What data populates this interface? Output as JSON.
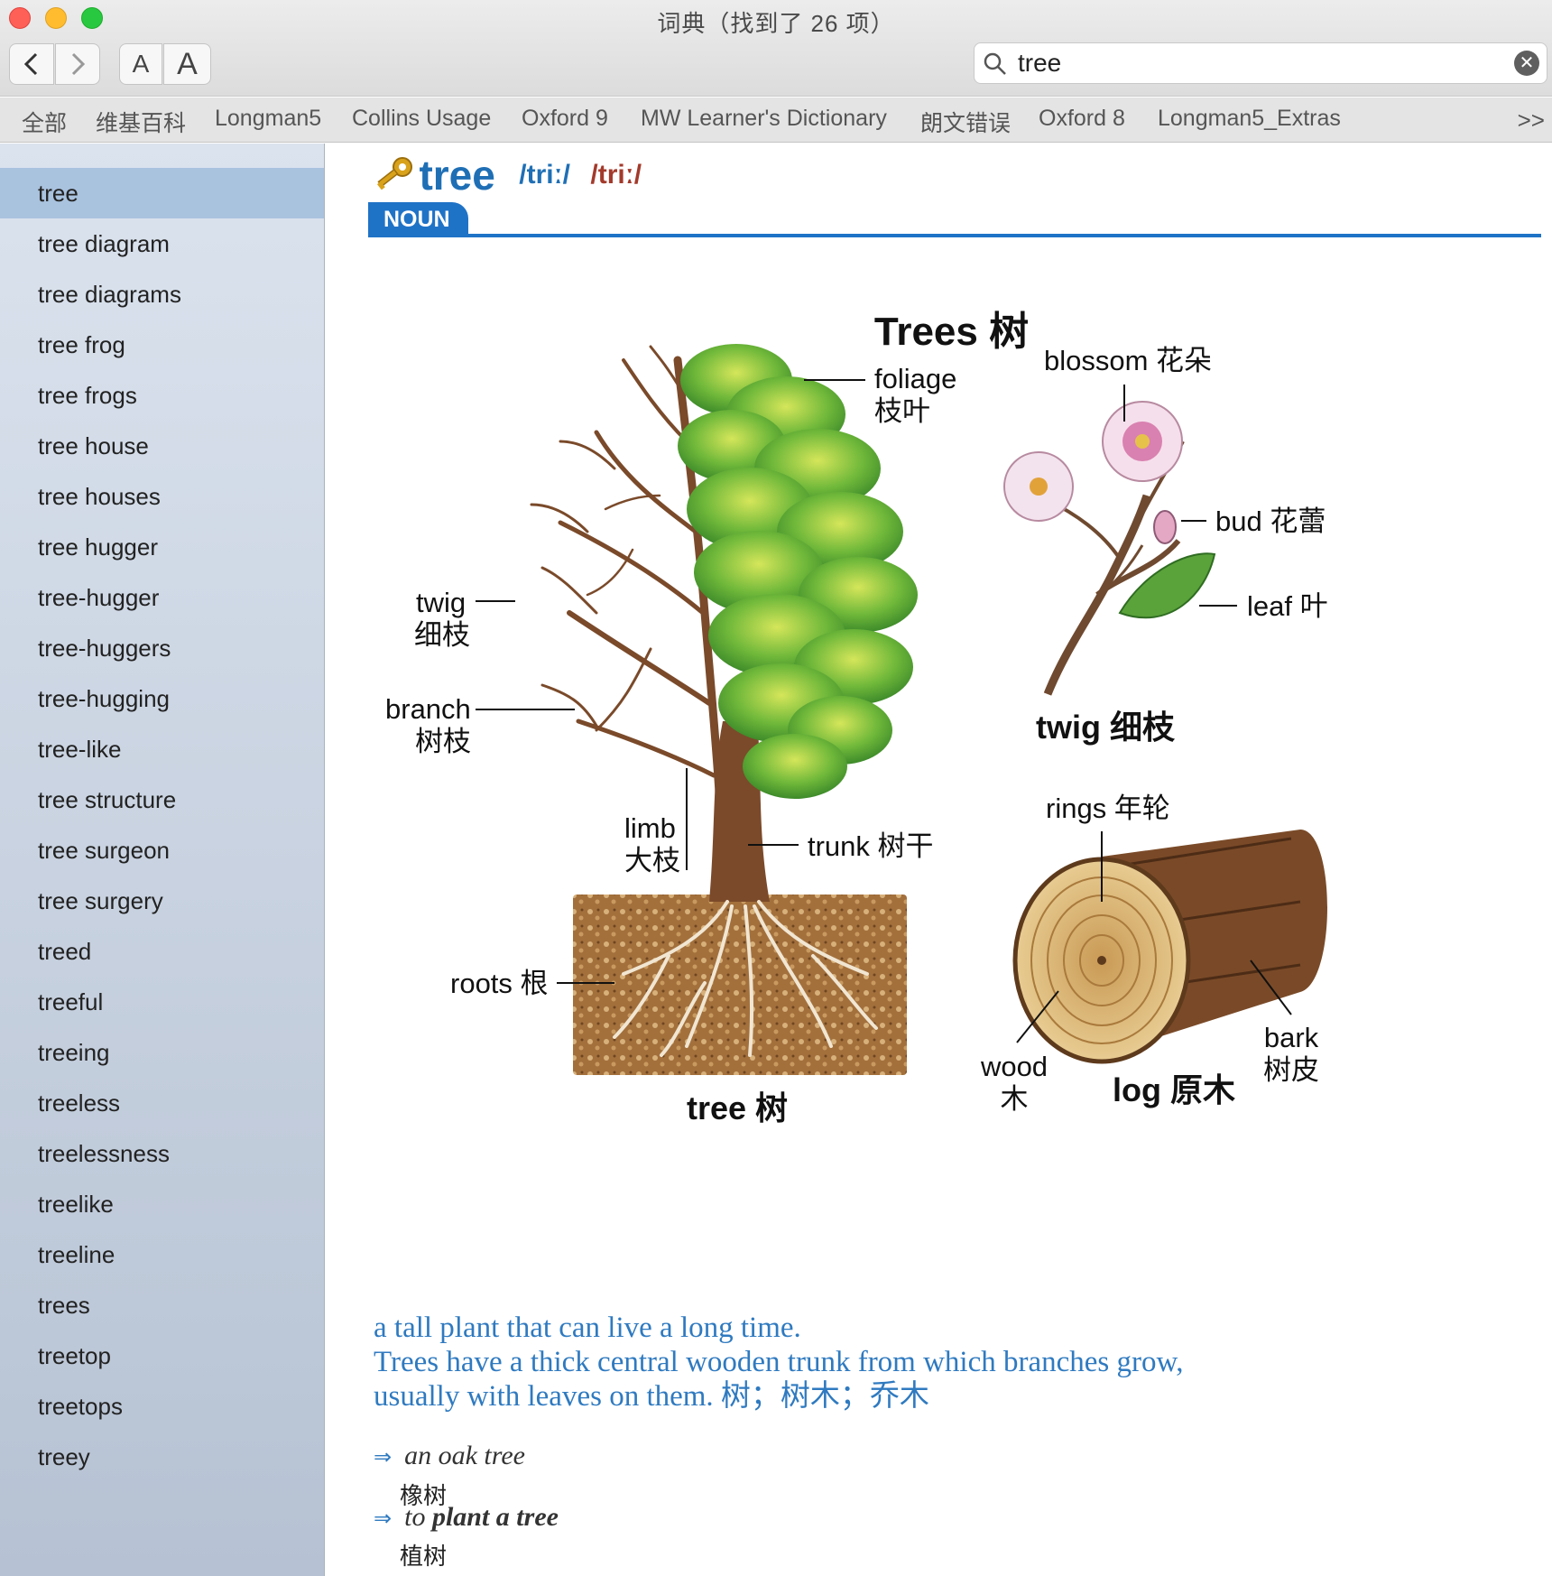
{
  "window": {
    "title": "词典（找到了 26 项）"
  },
  "toolbar": {
    "back_glyph": "‹",
    "forward_glyph": "›",
    "font_small_label": "A",
    "font_large_label": "A"
  },
  "search": {
    "value": "tree",
    "icon": "magnifier-icon",
    "clear_icon": "clear-circle-icon"
  },
  "dictionary_tabs": [
    "全部",
    "维基百科",
    "Longman5",
    "Collins Usage",
    "Oxford 9",
    "MW Learner's Dictionary",
    "朗文错误",
    "Oxford 8",
    "Longman5_Extras"
  ],
  "tabs_more": ">>",
  "sidebar": {
    "selected": "tree",
    "items": [
      "tree",
      "tree diagram",
      "tree diagrams",
      "tree frog",
      "tree frogs",
      "tree house",
      "tree houses",
      "tree hugger",
      "tree-hugger",
      "tree-huggers",
      "tree-hugging",
      "tree-like",
      "tree structure",
      "tree surgeon",
      "tree surgery",
      "treed",
      "treeful",
      "treeing",
      "treeless",
      "treelessness",
      "treelike",
      "treeline",
      "trees",
      "treetop",
      "treetops",
      "treey"
    ]
  },
  "entry": {
    "headword": "tree",
    "pron_br": "/triː/",
    "pron_us": "/triː/",
    "pos": "NOUN",
    "colors": {
      "accent_blue": "#1f73c7",
      "us_red": "#a33a2b"
    }
  },
  "illustration": {
    "title": "Trees  树",
    "labels": {
      "foliage": "foliage",
      "foliage_cn": "枝叶",
      "twig": "twig",
      "twig_cn": "细枝",
      "branch": "branch",
      "branch_cn": "树枝",
      "limb": "limb",
      "limb_cn": "大枝",
      "trunk": "trunk  树干",
      "roots": "roots  根",
      "tree_caption": "tree  树",
      "blossom": "blossom  花朵",
      "bud": "bud  花蕾",
      "leaf": "leaf  叶",
      "twig_caption": "twig  细枝",
      "rings": "rings  年轮",
      "wood": "wood",
      "wood_cn": "木",
      "bark": "bark",
      "bark_cn": "树皮",
      "log_caption": "log  原木"
    }
  },
  "definition": {
    "line1": "a tall plant that can live a long time.",
    "line2": "Trees have a thick central wooden trunk from which branches grow,",
    "line3": "usually with leaves on them. 树；树木；乔木"
  },
  "examples": [
    {
      "arrow": "⇒",
      "text": "an oak tree",
      "translation": "橡树"
    },
    {
      "arrow": "⇒",
      "pre": "to ",
      "bold": "plant a tree",
      "translation": "植树"
    }
  ]
}
